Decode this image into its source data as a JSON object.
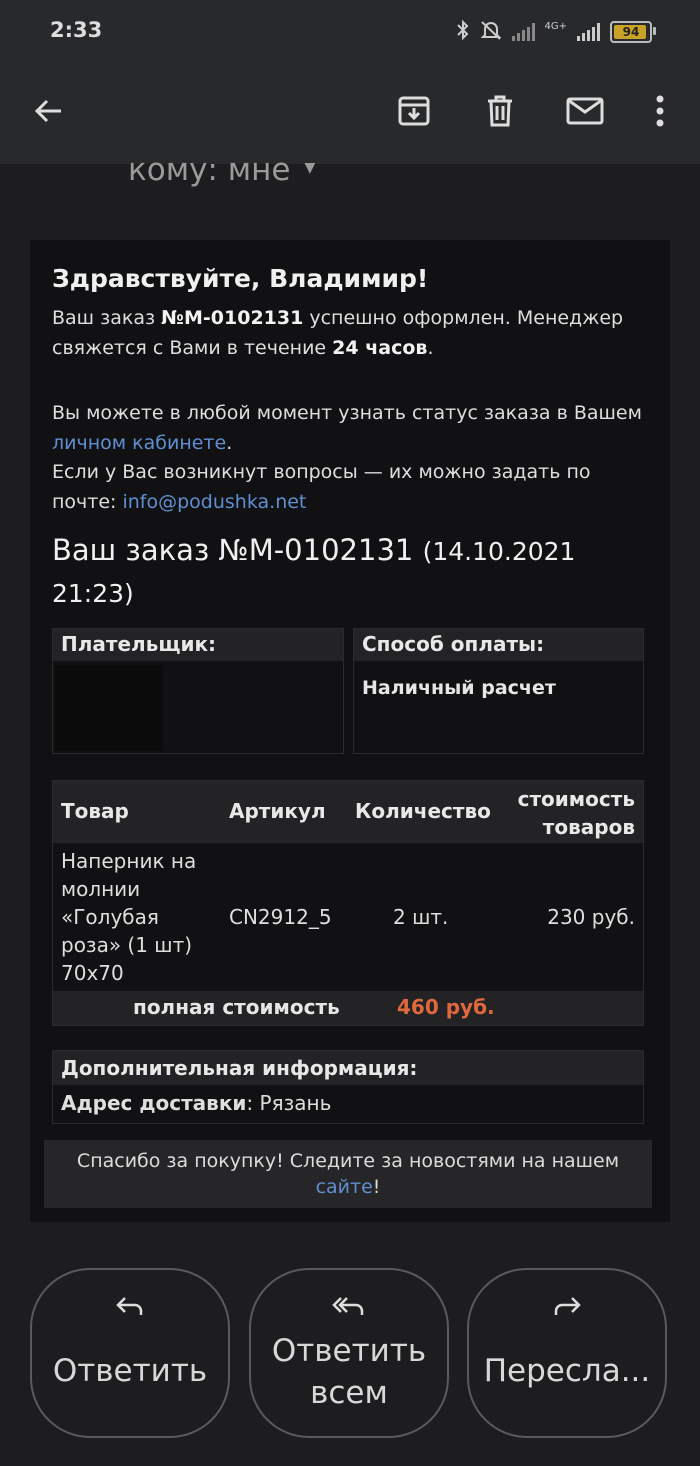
{
  "status_bar": {
    "time": "2:33",
    "network": "4G+",
    "battery": "94",
    "battery_level": 0.94,
    "icons": [
      "bluetooth-icon",
      "alarm-off-icon",
      "signal-weak-icon",
      "signal-4g-icon",
      "battery-icon"
    ]
  },
  "app_bar": {
    "icons": [
      "back-arrow-icon",
      "archive-icon",
      "delete-icon",
      "mark-unread-icon",
      "more-icon"
    ]
  },
  "recipient": "кому: мне",
  "email": {
    "greeting": "Здравствуйте, Владимир!",
    "p1_a": "Ваш заказ ",
    "p1_order": "№М-0102131",
    "p1_b": " успешно оформлен. Менеджер свяжется с Вами в течение ",
    "p1_hours": "24 часов",
    "p1_c": ".",
    "p2_a": "Вы можете в любой момент узнать статус заказа в Вашем ",
    "p2_link": "личном кабинете",
    "p2_b": ".",
    "p3_a": "Если у Вас возникнут вопросы — их можно задать по почте: ",
    "p3_email": "info@podushka.net",
    "order_title": "Ваш заказ №М-0102131",
    "order_date": "(14.10.2021 21:23)",
    "payer_label": "Плательщик:",
    "payment_label": "Способ оплаты:",
    "payment_value": "Наличный расчет",
    "table": {
      "headers": [
        "Товар",
        "Артикул",
        "Количество",
        "стоимость товаров"
      ],
      "rows": [
        {
          "item": "Наперник на молнии «Голубая роза» (1 шт) 70x70",
          "sku": "CN2912_5",
          "qty": "2 шт.",
          "price": "230 руб."
        }
      ],
      "total_label": "полная стоимость",
      "total_value": "460 руб."
    },
    "extra_label": "Дополнительная информация:",
    "address_label": "Адрес доставки",
    "address_value": ": Рязань",
    "thanks_a": "Спасибо за покупку! Следите за новостями на нашем ",
    "thanks_link": "сайте",
    "thanks_b": "!"
  },
  "actions": {
    "reply": "Ответить",
    "reply_all_1": "Ответить",
    "reply_all_2": "всем",
    "forward": "Пересла..."
  },
  "colors": {
    "link": "#5f8fd1",
    "total": "#e0683e",
    "battery": "#c9a227"
  }
}
